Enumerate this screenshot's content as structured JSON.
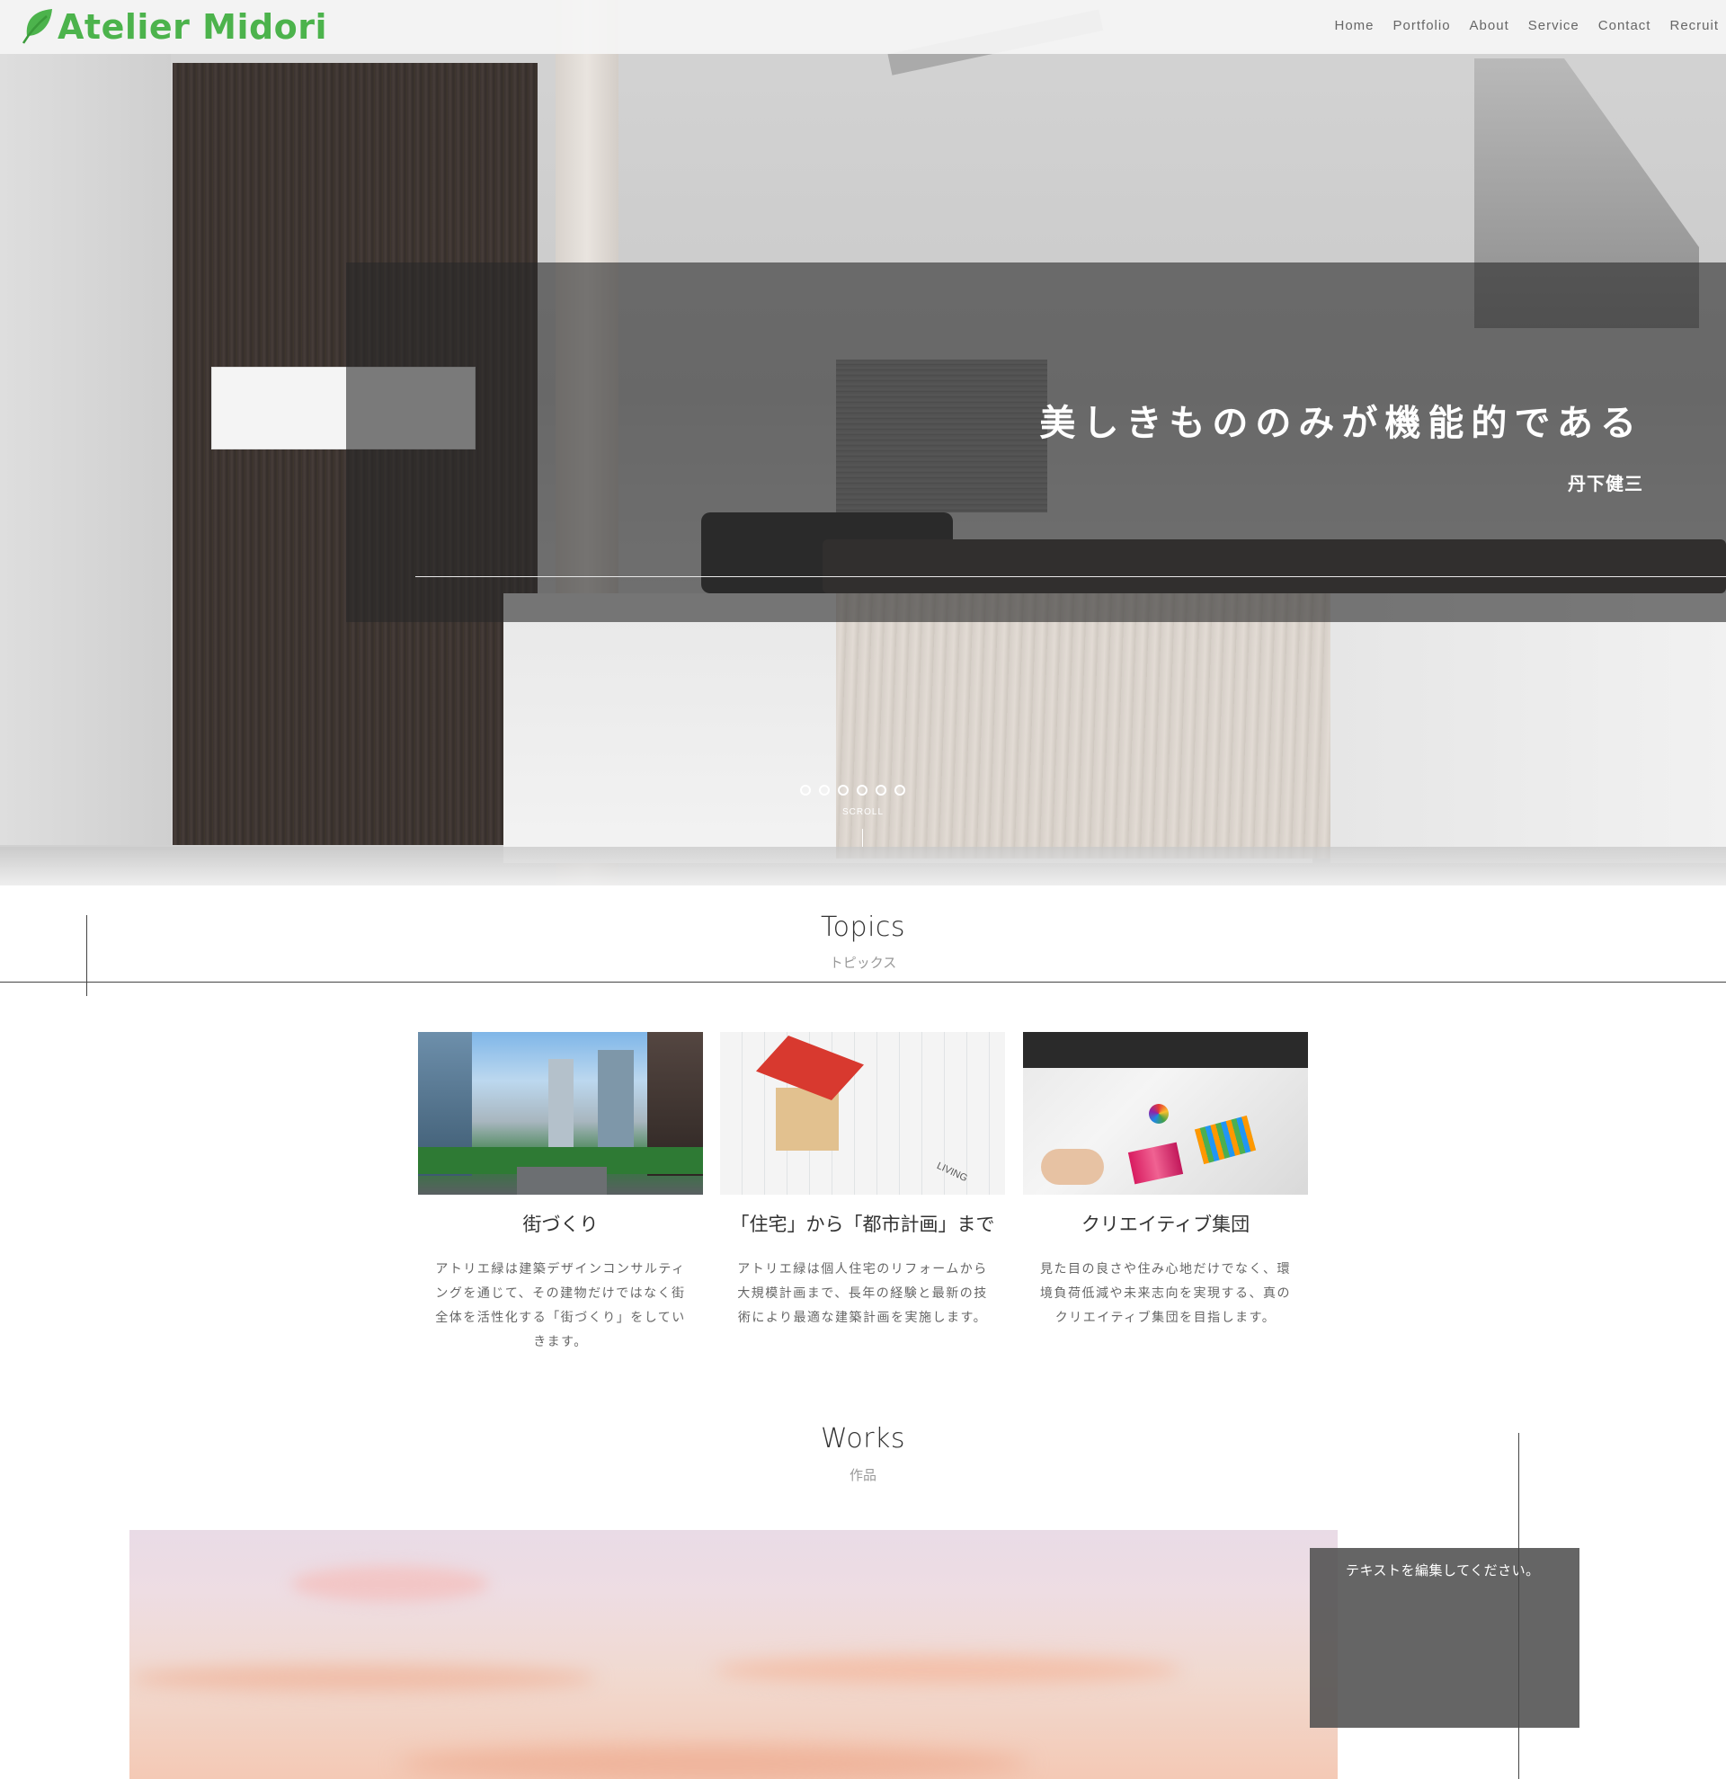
{
  "header": {
    "logo_text": "Atelier Midori",
    "logo_icon": "leaf-icon",
    "nav": [
      "Home",
      "Portfolio",
      "About",
      "Service",
      "Contact",
      "Recruit"
    ]
  },
  "hero": {
    "quote": "美しきもののみが機能的である",
    "author": "丹下健三",
    "slides_count": 6,
    "scroll_label": "SCROLL"
  },
  "topics": {
    "title": "Topics",
    "subtitle": "トピックス",
    "cards": [
      {
        "title": "街づくり",
        "text": "アトリエ緑は建築デザインコンサルティングを通じて、その建物だけではなく街全体を活性化する「街づくり」をしていきます。",
        "image": "city-photo"
      },
      {
        "title": "「住宅」から「都市計画」まで",
        "text": "アトリエ緑は個人住宅のリフォームから大規模計画まで、長年の経験と最新の技術により最適な建築計画を実施します。",
        "image": "house-model-photo",
        "image_labels": [
          "LIVING"
        ]
      },
      {
        "title": "クリエイティブ集団",
        "text": "見た目の良さや住み心地だけでなく、環境負荷低減や未来志向を実現する、真のクリエイティブ集団を目指します。",
        "image": "creative-team-photo"
      }
    ]
  },
  "works": {
    "title": "Works",
    "subtitle": "作品",
    "box_text": "テキストを編集してください。"
  },
  "colors": {
    "brand_green": "#4cb34c",
    "overlay": "#282828",
    "text": "#333333",
    "muted": "#999999"
  }
}
